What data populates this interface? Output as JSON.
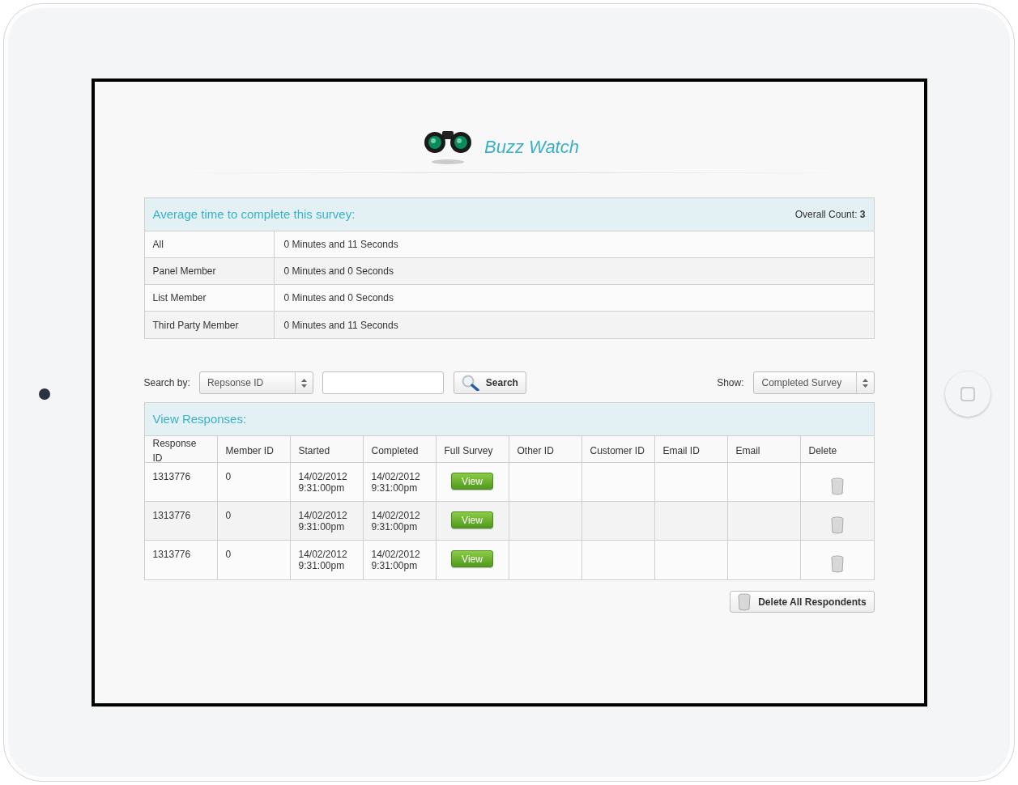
{
  "app": {
    "title": "Buzz Watch"
  },
  "summary": {
    "title": "Average time to complete this survey:",
    "count_label": "Overall Count:",
    "count_value": "3",
    "rows": [
      {
        "label": "All",
        "value": "0 Minutes and 11 Seconds"
      },
      {
        "label": "Panel Member",
        "value": "0 Minutes and 0 Seconds"
      },
      {
        "label": "List Member",
        "value": "0 Minutes and 0 Seconds"
      },
      {
        "label": "Third Party Member",
        "value": "0 Minutes and 11 Seconds"
      }
    ]
  },
  "search": {
    "label": "Search by:",
    "field": "Repsonse ID",
    "button": "Search",
    "show_label": "Show:",
    "show": "Completed Survey"
  },
  "responses": {
    "title": "View Responses:",
    "columns": [
      "Response ID",
      "Member ID",
      "Started",
      "Completed",
      "Full Survey",
      "Other ID",
      "Customer ID",
      "Email ID",
      "Email",
      "Delete"
    ],
    "rows": [
      {
        "response_id": "1313776",
        "member_id": "0",
        "started": "14/02/2012\n9:31:00pm",
        "completed": "14/02/2012\n9:31:00pm",
        "view": "View"
      },
      {
        "response_id": "1313776",
        "member_id": "0",
        "started": "14/02/2012\n9:31:00pm",
        "completed": "14/02/2012\n9:31:00pm",
        "view": "View"
      },
      {
        "response_id": "1313776",
        "member_id": "0",
        "started": "14/02/2012\n9:31:00pm",
        "completed": "14/02/2012\n9:31:00pm",
        "view": "View"
      }
    ],
    "delete_all": "Delete All Respondents"
  }
}
